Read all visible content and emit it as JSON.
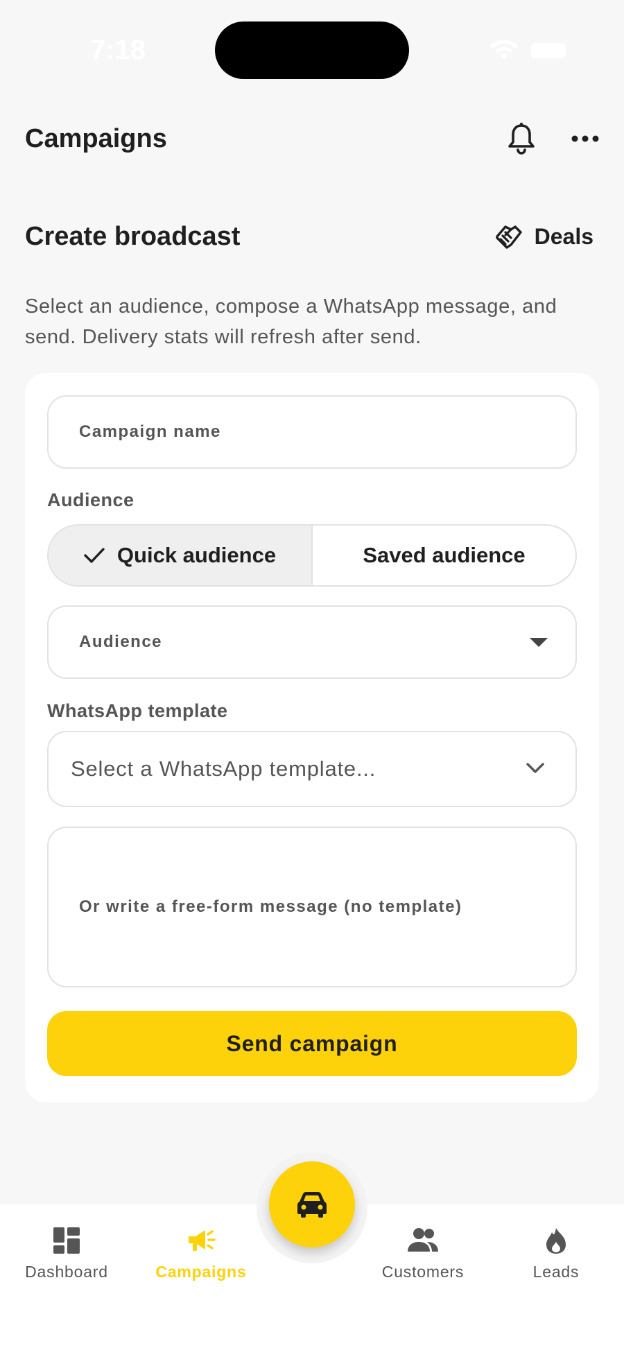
{
  "status_bar": {
    "time": "7:18"
  },
  "header": {
    "title": "Campaigns"
  },
  "section": {
    "title": "Create broadcast",
    "deals_label": "Deals",
    "description": "Select an audience, compose a WhatsApp message, and send. Delivery stats will refresh after send."
  },
  "form": {
    "campaign_name_label": "Campaign name",
    "audience_group_label": "Audience",
    "segments": {
      "quick": "Quick audience",
      "saved": "Saved audience",
      "selected": "quick"
    },
    "audience_select_label": "Audience",
    "template_group_label": "WhatsApp template",
    "template_placeholder": "Select a WhatsApp template...",
    "message_label": "Or write a free-form message (no template)",
    "send_label": "Send campaign"
  },
  "nav": {
    "items": [
      {
        "label": "Dashboard",
        "icon": "dashboard-icon",
        "active": false
      },
      {
        "label": "Campaigns",
        "icon": "megaphone-icon",
        "active": true
      },
      {
        "label": "Customers",
        "icon": "people-icon",
        "active": false
      },
      {
        "label": "Leads",
        "icon": "flame-icon",
        "active": false
      }
    ],
    "fab_icon": "car-icon"
  },
  "colors": {
    "accent": "#fdd20b",
    "text": "#1f1f1f",
    "muted": "#555555",
    "border": "#e2e2e2",
    "background": "#f7f7f7"
  }
}
